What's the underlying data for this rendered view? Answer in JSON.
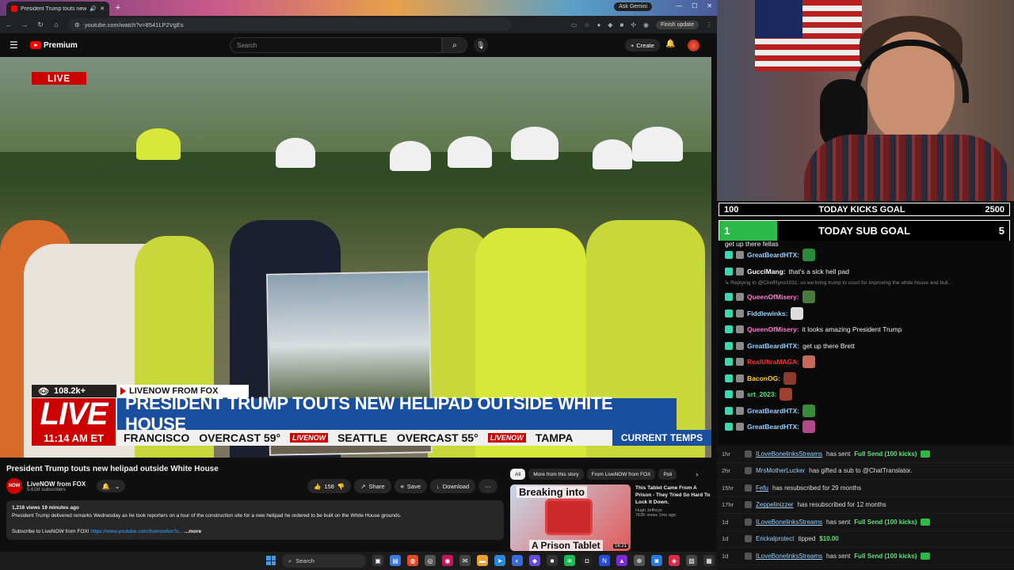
{
  "browser": {
    "tab_title": "President Trump touts new",
    "ask_gemini": "Ask Gemini",
    "url": "youtube.com/watch?v=8541LP2VgEs",
    "finish_update": "Finish update"
  },
  "youtube": {
    "logo_text": "Premium",
    "search_placeholder": "Search",
    "create_label": "Create"
  },
  "video": {
    "live_badge": "LIVE",
    "views": "108.2k+",
    "source": "LIVENOW FROM FOX",
    "big_live": "LIVE",
    "headline": "PRESIDENT TRUMP TOUTS NEW HELIPAD OUTSIDE WHITE HOUSE",
    "time": "11:14 AM ET",
    "ticker": [
      {
        "city": "FRANCISCO",
        "weather": "OVERCAST 59°"
      },
      {
        "city": "SEATTLE",
        "weather": "OVERCAST 55°"
      },
      {
        "city": "TAMPA",
        "weather": ""
      }
    ],
    "ticker_logo": "LIVENOW",
    "temps_label": "CURRENT TEMPS"
  },
  "watch": {
    "title": "President Trump touts new helipad outside White House",
    "channel": "LiveNOW from FOX",
    "channel_avatar": "NOW",
    "subscribers": "5.61M subscribers",
    "likes": "158",
    "share": "Share",
    "save": "Save",
    "download": "Download",
    "desc_meta": "1,216 views  19 minutes ago",
    "desc_body": "President Trump delivered remarks Wednesday as he took reporters on a tour of the construction site for a new helipad he ordered to be built on the White House grounds.",
    "desc_sub": "Subscribe to LiveNOW from FOX!",
    "desc_link": "https://www.youtube.com/livenowfox?s...",
    "desc_more": "...more"
  },
  "recs": {
    "chips": [
      "All",
      "More from this story",
      "From LiveNOW from FOX",
      "Poli"
    ],
    "item": {
      "thumb_top": "Breaking into",
      "thumb_bottom": "A Prison Tablet",
      "duration": "16:21",
      "title": "This Tablet Came From A Prison - They Tried So Hard To Lock It Down.",
      "channel": "Hugh Jeffreys",
      "stats": "762K views  1mo ago"
    }
  },
  "taskbar": {
    "search": "Search"
  },
  "overlay": {
    "kicks_goal": {
      "low": "100",
      "label": "TODAY KICKS GOAL",
      "high": "2500",
      "progress": 0.0
    },
    "sub_goal": {
      "low": "1",
      "label": "TODAY SUB GOAL",
      "high": "5",
      "progress": 0.2
    },
    "chat": [
      {
        "user": "",
        "text": "get up there fellas",
        "color": "#ffffff",
        "partial": true
      },
      {
        "user": "GreatBeardHTX:",
        "text": "",
        "color": "#9bd0ff",
        "emote": "#2a8a3a"
      },
      {
        "user": "GucciMang:",
        "text": "that's a sick hell pad",
        "color": "#ffffff"
      },
      {
        "reply": "Replying to @ChefRyno1031: so we bring trump to court for improving the white house and buil..."
      },
      {
        "user": "QueenOfMisery:",
        "text": "",
        "color": "#ff7ad0",
        "emote": "#4a7a3a"
      },
      {
        "user": "Fiddlewinks:",
        "text": "",
        "color": "#9bd0ff",
        "emote": "#dddddd"
      },
      {
        "user": "QueenOfMisery:",
        "text": "it looks amazing President Trump",
        "color": "#ff7ad0"
      },
      {
        "user": "GreatBeardHTX:",
        "text": "get up there Brett",
        "color": "#9bd0ff"
      },
      {
        "user": "RealUltraMAGA:",
        "text": "",
        "color": "#ff3030",
        "emote": "#c86a5a"
      },
      {
        "user": "BaconOG:",
        "text": "",
        "color": "#ffd23a",
        "emote": "#8a3a2a"
      },
      {
        "user": "srt_2023:",
        "text": "",
        "color": "#5ee07a",
        "emote": "#a04030"
      },
      {
        "user": "GreatBeardHTX:",
        "text": "",
        "color": "#9bd0ff",
        "emote": "#3a8a3a"
      },
      {
        "user": "GreatBeardHTX:",
        "text": "",
        "color": "#9bd0ff",
        "emote": "#b04a8a"
      }
    ],
    "events": [
      {
        "ago": "1hr",
        "who": "ILoveBonelinksStreams",
        "act": "has sent",
        "hl": "Full Send (100 kicks)",
        "kick": true
      },
      {
        "ago": "2hr",
        "who": "MrsMotherLucker",
        "act": "has gifted a sub to @ChatTranslator.",
        "plain": true
      },
      {
        "ago": "15hr",
        "who": "Fefu",
        "act": "has resubscribed for 29 months"
      },
      {
        "ago": "17hr",
        "who": "Zeppelinizzer",
        "act": "has resubscribed for 12 months"
      },
      {
        "ago": "1d",
        "who": "ILoveBonelinksStreams",
        "act": "has sent",
        "hl": "Full Send (100 kicks)",
        "kick": true
      },
      {
        "ago": "1d",
        "who": "Erickalprotect",
        "act": "tipped",
        "hl": "$10.00",
        "plain": true
      },
      {
        "ago": "1d",
        "who": "ILoveBonelinksStreams",
        "act": "has sent",
        "hl": "Full Send (100 kicks)",
        "kick": true
      }
    ]
  }
}
